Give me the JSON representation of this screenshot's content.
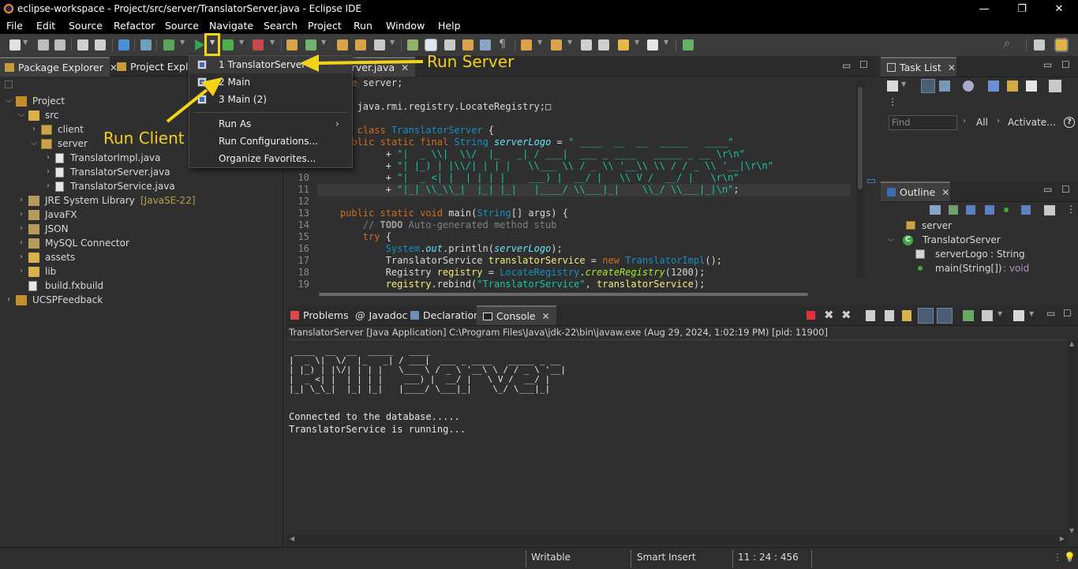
{
  "window": {
    "title": "eclipse-workspace - Project/src/server/TranslatorServer.java - Eclipse IDE",
    "minimize": "—",
    "maximize": "❐",
    "close": "✕"
  },
  "menubar": [
    "File",
    "Edit",
    "Source",
    "Refactor",
    "Source",
    "Navigate",
    "Search",
    "Project",
    "Run",
    "Window",
    "Help"
  ],
  "left_panel": {
    "tabs": [
      {
        "label": "Package Explorer",
        "active": true
      },
      {
        "label": "Project Explor",
        "active": false
      }
    ],
    "tree": [
      {
        "label": "Project",
        "depth": 0,
        "expanded": true,
        "icon": "project-icon"
      },
      {
        "label": "src",
        "depth": 1,
        "expanded": true,
        "icon": "source-folder-icon"
      },
      {
        "label": "client",
        "depth": 2,
        "expanded": false,
        "icon": "package-icon"
      },
      {
        "label": "server",
        "depth": 2,
        "expanded": true,
        "icon": "package-icon"
      },
      {
        "label": "TranslatorImpl.java",
        "depth": 3,
        "expanded": false,
        "icon": "java-file-icon"
      },
      {
        "label": "TranslatorServer.java",
        "depth": 3,
        "expanded": false,
        "icon": "java-file-icon"
      },
      {
        "label": "TranslatorService.java",
        "depth": 3,
        "expanded": false,
        "icon": "java-file-icon"
      },
      {
        "label": "JRE System Library",
        "decoration": "[JavaSE-22]",
        "depth": 1,
        "expanded": false,
        "icon": "library-icon"
      },
      {
        "label": "JavaFX",
        "depth": 1,
        "expanded": false,
        "icon": "library-icon"
      },
      {
        "label": "JSON",
        "depth": 1,
        "expanded": false,
        "icon": "library-icon"
      },
      {
        "label": "MySQL Connector",
        "depth": 1,
        "expanded": false,
        "icon": "library-icon"
      },
      {
        "label": "assets",
        "depth": 1,
        "expanded": false,
        "icon": "folder-icon"
      },
      {
        "label": "lib",
        "depth": 1,
        "expanded": false,
        "icon": "folder-icon"
      },
      {
        "label": "build.fxbuild",
        "depth": 1,
        "expanded": null,
        "icon": "file-icon"
      },
      {
        "label": "UCSPFeedback",
        "depth": 0,
        "expanded": false,
        "icon": "project-icon"
      }
    ]
  },
  "editor": {
    "tab_label": "erver.java",
    "lines": [
      {
        "n": "",
        "html": "<span class='kw'>package</span> server;"
      },
      {
        "n": "",
        "html": ""
      },
      {
        "n": "",
        "html": "<span class='kw'>import</span> java.rmi.registry.LocateRegistry;&#9633;"
      },
      {
        "n": "",
        "html": ""
      },
      {
        "n": "",
        "html": "<span class='kw'>public</span> <span class='kw'>class</span> <span class='ty'>TranslatorServer</span> {"
      },
      {
        "n": "",
        "html": "    <span class='kw'>public</span> <span class='kw'>static</span> <span class='kw'>final</span> <span class='ty'>String</span> <span class='fld'>serverLogo</span> = <span class='st'>\" ____  __  __  _____   ____\"</span>"
      },
      {
        "n": "",
        "html": "            + <span class='st'>\"|  _ \\\\|  \\\\/  |_   _| / ___|  ___ _ ____   _____ _ __ \\r\\n\"</span>"
      },
      {
        "n": "",
        "html": "            + <span class='st'>\"| |_) | |\\\\/| | | |   \\\\___ \\\\ / _ \\\\ '__\\\\ \\\\ / / _ \\\\ '__|\\r\\n\"</span>"
      },
      {
        "n": "10",
        "html": "            + <span class='st'>\"|  _ <| |  | | | |    ___) |  __/ |   \\\\ V /  __/ |   \\r\\n\"</span>"
      },
      {
        "n": "11",
        "html": "            + <span class='st'>\"|_| \\\\_\\\\_|  |_| |_|   |____/ \\\\___|_|    \\\\_/ \\\\___|_|\\n\"</span>;"
      },
      {
        "n": "12",
        "html": ""
      },
      {
        "n": "13",
        "html": "    <span class='kw'>public</span> <span class='kw'>static</span> <span class='kw'>void</span> main(<span class='ty'>String</span>[] args) {"
      },
      {
        "n": "14",
        "html": "        <span class='cm'>// <b style='color:#a0a0a0'>TODO</b> Auto-generated method stub</span>"
      },
      {
        "n": "15",
        "html": "        <span class='kw'>try</span> {"
      },
      {
        "n": "16",
        "html": "            <span class='ty'>System</span>.<span class='fld'>out</span>.println(<span class='fld'>serverLogo</span>);"
      },
      {
        "n": "17",
        "html": "            TranslatorService <span class='var'>translatorService</span> = <span class='kw'>new</span> <span class='ty'>TranslatorImpl</span>();"
      },
      {
        "n": "18",
        "html": "            Registry <span class='var'>registry</span> = <span class='ty'>LocateRegistry</span>.<span class='mth'>createRegistry</span>(1200);"
      },
      {
        "n": "19",
        "html": "            <span class='var'>registry</span>.rebind(<span class='st'>\"TranslatorService\"</span>, <span class='var'>translatorService</span>);"
      }
    ]
  },
  "run_menu": {
    "items": [
      {
        "label": "1 TranslatorServer",
        "icon": true
      },
      {
        "label": "2 Main",
        "icon": true
      },
      {
        "label": "3 Main (2)",
        "icon": true
      },
      {
        "label": "Run As",
        "submenu": true
      },
      {
        "label": "Run Configurations...",
        "icon": false
      },
      {
        "label": "Organize Favorites...",
        "icon": false
      }
    ]
  },
  "annotations": {
    "run_server": "Run Server",
    "run_client": "Run Client",
    "color": "#f5d21a"
  },
  "task_list": {
    "tab_label": "Task List",
    "find_placeholder": "Find",
    "all_label": "All",
    "activate_label": "Activate..."
  },
  "outline": {
    "tab_label": "Outline",
    "items": [
      {
        "label": "server",
        "type": "package"
      },
      {
        "label": "TranslatorServer",
        "type": "class"
      },
      {
        "label": "serverLogo",
        "detail": " : String",
        "type": "field"
      },
      {
        "label": "main(String[])",
        "detail": " : void",
        "type": "method"
      }
    ]
  },
  "bottom_panel": {
    "tabs": [
      "Problems",
      "Javadoc",
      "Declaration",
      "Console"
    ],
    "active_tab": "Console",
    "launch_info": "TranslatorServer [Java Application] C:\\Program Files\\Java\\jdk-22\\bin\\javaw.exe  (Aug 29, 2024, 1:02:19 PM) [pid: 11900]",
    "output_logo": [
      " ____  __  __  _____   ____",
      "|  _ \\|  \\/  |_   _| / ___|  ___ _ ____   _____ _ __",
      "| |_) | |\\/| | | |   \\___ \\ / _ \\ '__\\ \\ / / _ \\ '__|",
      "|  _ <| |  | | | |    ___) |  __/ |   \\ V /  __/ |",
      "|_| \\_\\_|  |_| |_|   |____/ \\___|_|    \\_/ \\___|_|"
    ],
    "output_lines": [
      "Connected to the database.....",
      "TranslatorService is running..."
    ]
  },
  "statusbar": {
    "mode": "Writable",
    "insert": "Smart Insert",
    "position": "11 : 24 : 456"
  }
}
